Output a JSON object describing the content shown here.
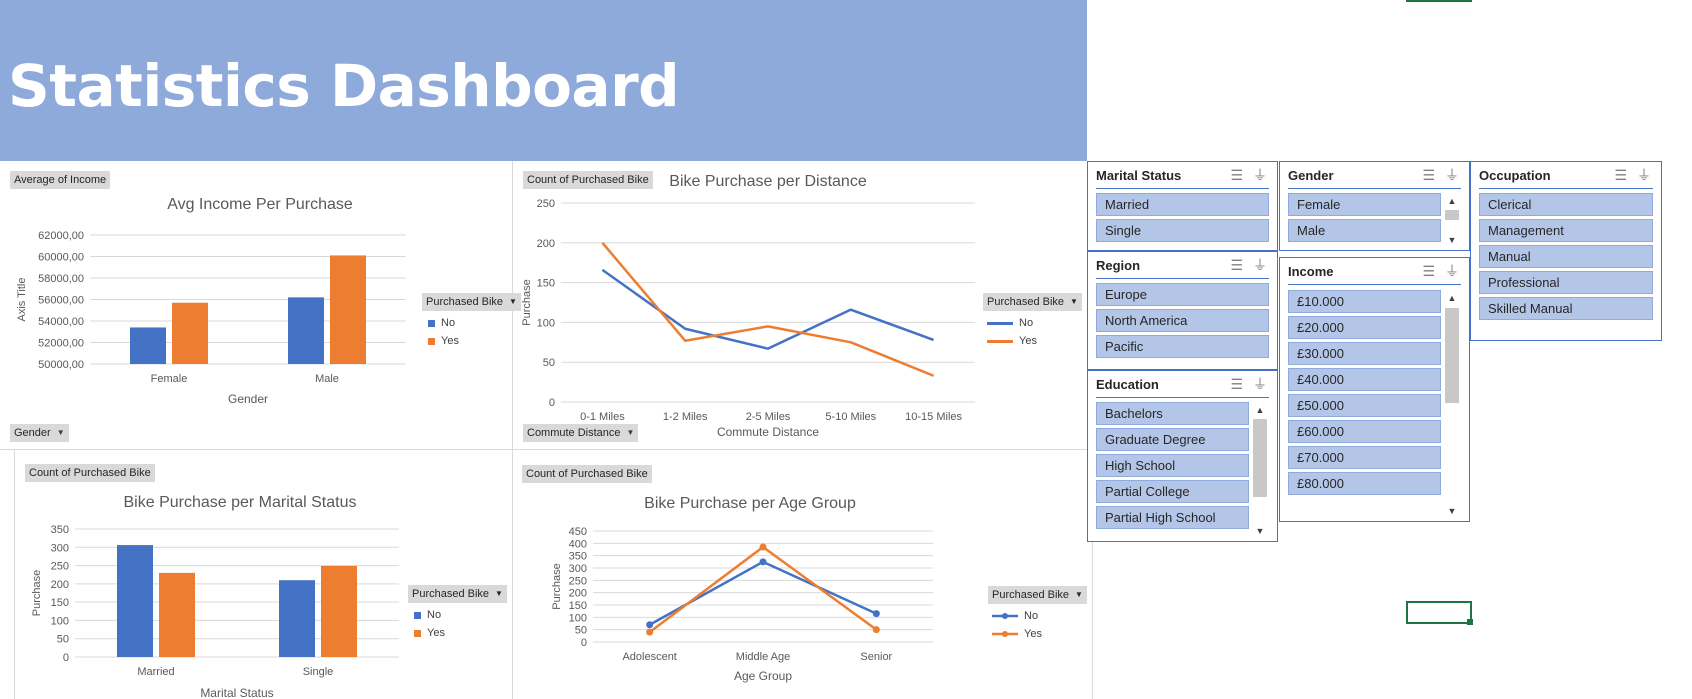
{
  "dashboard": {
    "title": "Statistics Dashboard"
  },
  "colors": {
    "no": "#4472c4",
    "yes": "#ed7d31",
    "banner": "#8eaadb",
    "slicer_item": "#b4c6e7",
    "slicer_border": "#4472c4"
  },
  "pivot_buttons": {
    "avg_income_value": "Average of Income",
    "gender_axis": "Gender",
    "count_distance": "Count of Purchased Bike",
    "commute_axis": "Commute Distance",
    "count_marital": "Count of Purchased Bike",
    "count_age": "Count of Purchased Bike"
  },
  "legend": {
    "title": "Purchased Bike",
    "no": "No",
    "yes": "Yes"
  },
  "chart_data": [
    {
      "type": "bar",
      "title": "Avg Income Per Purchase",
      "xlabel": "Gender",
      "ylabel": "Axis Title",
      "categories": [
        "Female",
        "Male"
      ],
      "series": [
        {
          "name": "No",
          "values": [
            53400,
            56200
          ]
        },
        {
          "name": "Yes",
          "values": [
            55700,
            60100
          ]
        }
      ],
      "ylim": [
        50000,
        62000
      ],
      "yticks": [
        "50000,00",
        "52000,00",
        "54000,00",
        "56000,00",
        "58000,00",
        "60000,00",
        "62000,00"
      ],
      "grid": true,
      "legend": "right"
    },
    {
      "type": "line",
      "title": "Bike Purchase per Distance",
      "xlabel": "Commute Distance",
      "ylabel": "Purchase",
      "categories": [
        "0-1 Miles",
        "1-2 Miles",
        "2-5 Miles",
        "5-10 Miles",
        "10-15 Miles"
      ],
      "series": [
        {
          "name": "No",
          "values": [
            166,
            92,
            67,
            116,
            78
          ]
        },
        {
          "name": "Yes",
          "values": [
            200,
            77,
            95,
            75,
            33
          ]
        }
      ],
      "ylim": [
        0,
        250
      ],
      "yticks": [
        "0",
        "50",
        "100",
        "150",
        "200",
        "250"
      ],
      "grid": true,
      "legend": "right"
    },
    {
      "type": "bar",
      "title": "Bike Purchase per Marital Status",
      "xlabel": "Marital Status",
      "ylabel": "Purchase",
      "categories": [
        "Married",
        "Single"
      ],
      "series": [
        {
          "name": "No",
          "values": [
            306,
            210
          ]
        },
        {
          "name": "Yes",
          "values": [
            230,
            249
          ]
        }
      ],
      "ylim": [
        0,
        350
      ],
      "yticks": [
        "0",
        "50",
        "100",
        "150",
        "200",
        "250",
        "300",
        "350"
      ],
      "grid": true,
      "legend": "right"
    },
    {
      "type": "line",
      "title": "Bike Purchase per Age Group",
      "xlabel": "Age Group",
      "ylabel": "Purchase",
      "categories": [
        "Adolescent",
        "Middle Age",
        "Senior"
      ],
      "series": [
        {
          "name": "No",
          "values": [
            70,
            325,
            115
          ]
        },
        {
          "name": "Yes",
          "values": [
            40,
            385,
            50
          ]
        }
      ],
      "ylim": [
        0,
        450
      ],
      "yticks": [
        "0",
        "50",
        "100",
        "150",
        "200",
        "250",
        "300",
        "350",
        "400",
        "450"
      ],
      "grid": true,
      "legend": "right",
      "markers": true
    }
  ],
  "slicers": {
    "marital": {
      "title": "Marital Status",
      "items": [
        "Married",
        "Single"
      ]
    },
    "region": {
      "title": "Region",
      "items": [
        "Europe",
        "North America",
        "Pacific"
      ]
    },
    "education": {
      "title": "Education",
      "items": [
        "Bachelors",
        "Graduate Degree",
        "High School",
        "Partial College",
        "Partial High School"
      ]
    },
    "gender": {
      "title": "Gender",
      "items": [
        "Female",
        "Male"
      ]
    },
    "income": {
      "title": "Income",
      "items": [
        "£10.000",
        "£20.000",
        "£30.000",
        "£40.000",
        "£50.000",
        "£60.000",
        "£70.000",
        "£80.000"
      ]
    },
    "occupation": {
      "title": "Occupation",
      "items": [
        "Clerical",
        "Management",
        "Manual",
        "Professional",
        "Skilled Manual"
      ]
    }
  },
  "icons": {
    "multi_select": "multi-select-icon",
    "clear_filter": "clear-filter-icon"
  }
}
